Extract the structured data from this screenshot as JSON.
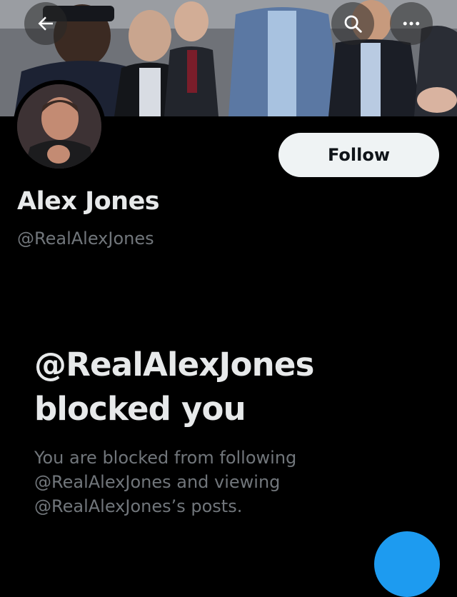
{
  "profile": {
    "display_name": "Alex Jones",
    "handle": "@RealAlexJones"
  },
  "header": {
    "back_icon": "arrow-left-icon",
    "search_icon": "search-icon",
    "more_icon": "more-horizontal-icon"
  },
  "actions": {
    "follow_label": "Follow"
  },
  "blocked": {
    "title_line1": "@RealAlexJones",
    "title_line2": "blocked you",
    "desc_line1": "You are blocked from following",
    "desc_line2": "@RealAlexJones and viewing",
    "desc_line3": "@RealAlexJones’s posts."
  },
  "colors": {
    "background": "#000000",
    "primary_text": "#e7e9ea",
    "secondary_text": "#71767b",
    "button_bg": "#eff3f4",
    "accent": "#1d9bf0"
  }
}
